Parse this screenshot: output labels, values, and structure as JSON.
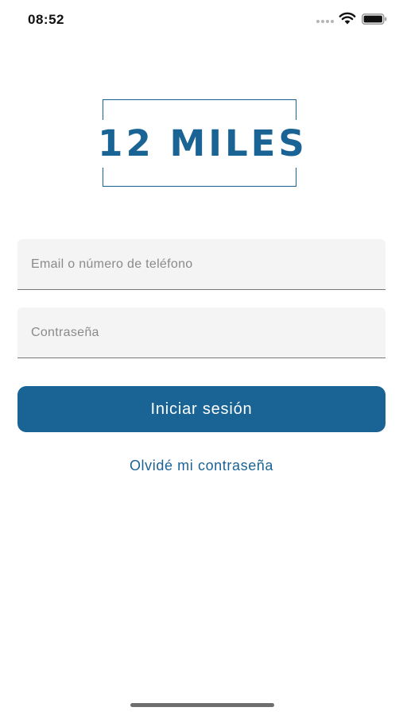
{
  "status_bar": {
    "time": "08:52",
    "icons": [
      "signal-dots-icon",
      "wifi-icon",
      "battery-icon"
    ]
  },
  "logo": {
    "text": "12 MILES",
    "color": "#1a6495"
  },
  "form": {
    "email_placeholder": "Email o número de teléfono",
    "email_value": "",
    "password_placeholder": "Contraseña",
    "password_value": "",
    "login_label": "Iniciar sesión",
    "forgot_label": "Olvidé mi contraseña"
  },
  "colors": {
    "primary": "#1a6495",
    "field_background": "#f4f4f4",
    "background": "#ffffff"
  }
}
